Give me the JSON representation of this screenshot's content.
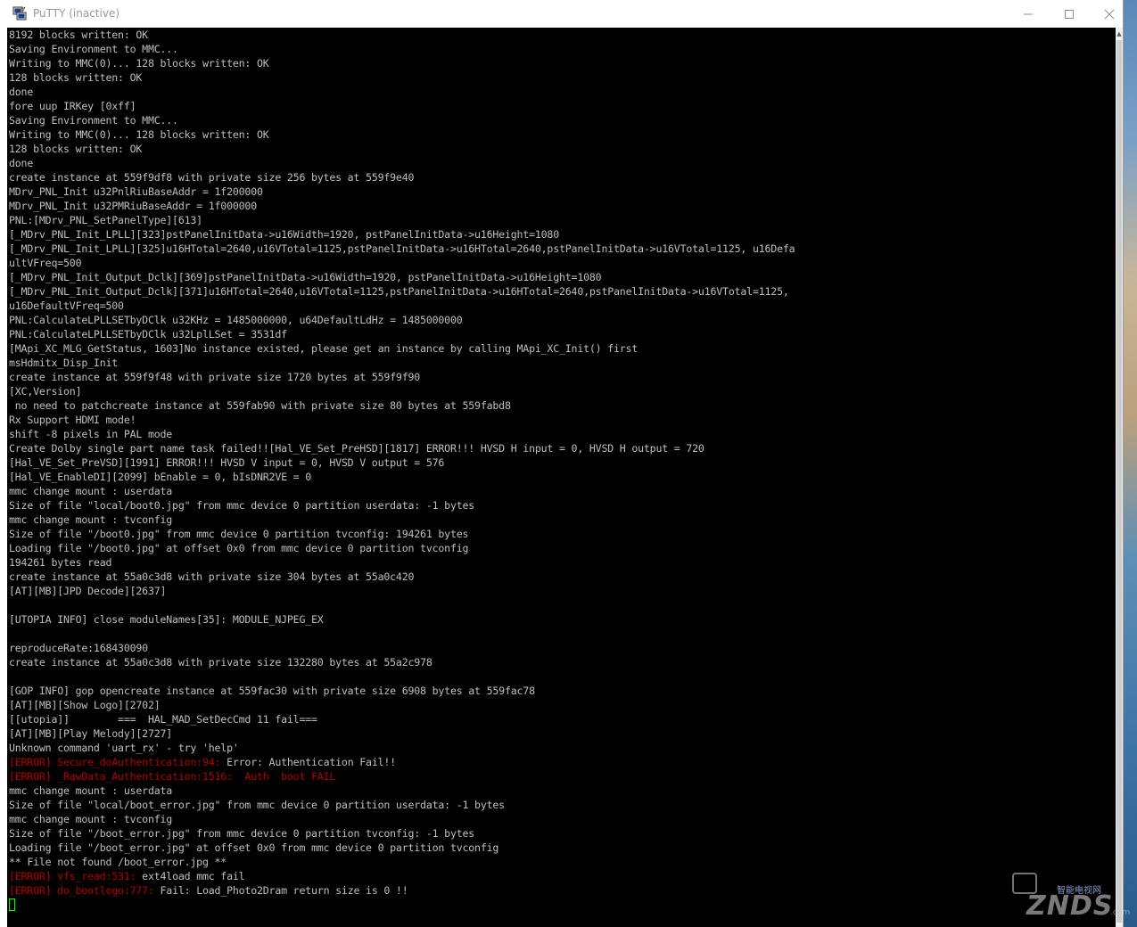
{
  "window": {
    "title": "PuTTY (inactive)",
    "minimize_icon": "minimize-icon",
    "maximize_icon": "maximize-icon",
    "close_icon": "close-icon",
    "app_icon": "putty-icon"
  },
  "terminal": {
    "colors": {
      "background": "#000000",
      "text": "#bfbfbf",
      "error": "#b40000",
      "cursor": "#00ff00"
    },
    "lines": [
      [
        {
          "t": "8192 blocks written: OK"
        }
      ],
      [
        {
          "t": "Saving Environment to MMC..."
        }
      ],
      [
        {
          "t": "Writing to MMC(0)... 128 blocks written: OK"
        }
      ],
      [
        {
          "t": "128 blocks written: OK"
        }
      ],
      [
        {
          "t": "done"
        }
      ],
      [
        {
          "t": "fore uup IRKey [0xff]"
        }
      ],
      [
        {
          "t": "Saving Environment to MMC..."
        }
      ],
      [
        {
          "t": "Writing to MMC(0)... 128 blocks written: OK"
        }
      ],
      [
        {
          "t": "128 blocks written: OK"
        }
      ],
      [
        {
          "t": "done"
        }
      ],
      [
        {
          "t": "create instance at 559f9df8 with private size 256 bytes at 559f9e40"
        }
      ],
      [
        {
          "t": "MDrv_PNL_Init u32PnlRiuBaseAddr = 1f200000"
        }
      ],
      [
        {
          "t": "MDrv_PNL_Init u32PMRiuBaseAddr = 1f000000"
        }
      ],
      [
        {
          "t": "PNL:[MDrv_PNL_SetPanelType][613]"
        }
      ],
      [
        {
          "t": "[_MDrv_PNL_Init_LPLL][323]pstPanelInitData->u16Width=1920, pstPanelInitData->u16Height=1080"
        }
      ],
      [
        {
          "t": "[_MDrv_PNL_Init_LPLL][325]u16HTotal=2640,u16VTotal=1125,pstPanelInitData->u16HTotal=2640,pstPanelInitData->u16VTotal=1125, u16Defa"
        }
      ],
      [
        {
          "t": "ultVFreq=500"
        }
      ],
      [
        {
          "t": "[_MDrv_PNL_Init_Output_Dclk][369]pstPanelInitData->u16Width=1920, pstPanelInitData->u16Height=1080"
        }
      ],
      [
        {
          "t": "[_MDrv_PNL_Init_Output_Dclk][371]u16HTotal=2640,u16VTotal=1125,pstPanelInitData->u16HTotal=2640,pstPanelInitData->u16VTotal=1125,"
        }
      ],
      [
        {
          "t": "u16DefaultVFreq=500"
        }
      ],
      [
        {
          "t": "PNL:CalculateLPLLSETbyDClk u32KHz = 1485000000, u64DefaultLdHz = 1485000000"
        }
      ],
      [
        {
          "t": "PNL:CalculateLPLLSETbyDClk u32LplLSet = 3531df"
        }
      ],
      [
        {
          "t": "[MApi_XC_MLG_GetStatus, 1603]No instance existed, please get an instance by calling MApi_XC_Init() first"
        }
      ],
      [
        {
          "t": "msHdmitx_Disp_Init"
        }
      ],
      [
        {
          "t": "create instance at 559f9f48 with private size 1720 bytes at 559f9f90"
        }
      ],
      [
        {
          "t": "[XC,Version]"
        }
      ],
      [
        {
          "t": " no need to patchcreate instance at 559fab90 with private size 80 bytes at 559fabd8"
        }
      ],
      [
        {
          "t": "Rx Support HDMI mode!"
        }
      ],
      [
        {
          "t": "shift -8 pixels in PAL mode"
        }
      ],
      [
        {
          "t": "Create Dolby single part name task failed!![Hal_VE_Set_PreHSD][1817] ERROR!!! HVSD H input = 0, HVSD H output = 720"
        }
      ],
      [
        {
          "t": "[Hal_VE_Set_PreVSD][1991] ERROR!!! HVSD V input = 0, HVSD V output = 576"
        }
      ],
      [
        {
          "t": "[Hal_VE_EnableDI][2099] bEnable = 0, bIsDNR2VE = 0"
        }
      ],
      [
        {
          "t": "mmc change mount : userdata"
        }
      ],
      [
        {
          "t": "Size of file \"local/boot0.jpg\" from mmc device 0 partition userdata: -1 bytes"
        }
      ],
      [
        {
          "t": "mmc change mount : tvconfig"
        }
      ],
      [
        {
          "t": "Size of file \"/boot0.jpg\" from mmc device 0 partition tvconfig: 194261 bytes"
        }
      ],
      [
        {
          "t": "Loading file \"/boot0.jpg\" at offset 0x0 from mmc device 0 partition tvconfig"
        }
      ],
      [
        {
          "t": "194261 bytes read"
        }
      ],
      [
        {
          "t": "create instance at 55a0c3d8 with private size 304 bytes at 55a0c420"
        }
      ],
      [
        {
          "t": "[AT][MB][JPD Decode][2637]"
        }
      ],
      [
        {
          "t": ""
        }
      ],
      [
        {
          "t": "[UTOPIA INFO] close moduleNames[35]: MODULE_NJPEG_EX"
        }
      ],
      [
        {
          "t": ""
        }
      ],
      [
        {
          "t": "reproduceRate:168430090"
        }
      ],
      [
        {
          "t": "create instance at 55a0c3d8 with private size 132280 bytes at 55a2c978"
        }
      ],
      [
        {
          "t": ""
        }
      ],
      [
        {
          "t": "[GOP INFO] gop opencreate instance at 559fac30 with private size 6908 bytes at 559fac78"
        }
      ],
      [
        {
          "t": "[AT][MB][Show Logo][2702]"
        }
      ],
      [
        {
          "t": "[[utopia]]        ===  HAL_MAD_SetDecCmd 11 fail==="
        }
      ],
      [
        {
          "t": "[AT][MB][Play Melody][2727]"
        }
      ],
      [
        {
          "t": "Unknown command 'uart_rx' - try 'help'"
        }
      ],
      [
        {
          "t": "[ERROR] Secure_doAuthentication:94: ",
          "c": "red"
        },
        {
          "t": "Error: Authentication Fail!!"
        }
      ],
      [
        {
          "t": "[ERROR] _RawData_Authentication:1516:  Auth  boot FAIL",
          "c": "red"
        }
      ],
      [
        {
          "t": "mmc change mount : userdata"
        }
      ],
      [
        {
          "t": "Size of file \"local/boot_error.jpg\" from mmc device 0 partition userdata: -1 bytes"
        }
      ],
      [
        {
          "t": "mmc change mount : tvconfig"
        }
      ],
      [
        {
          "t": "Size of file \"/boot_error.jpg\" from mmc device 0 partition tvconfig: -1 bytes"
        }
      ],
      [
        {
          "t": "Loading file \"/boot_error.jpg\" at offset 0x0 from mmc device 0 partition tvconfig"
        }
      ],
      [
        {
          "t": "** File not found /boot_error.jpg **"
        }
      ],
      [
        {
          "t": "[ERROR] vfs_read:531: ",
          "c": "red"
        },
        {
          "t": "ext4load mmc fail"
        }
      ],
      [
        {
          "t": "[ERROR] do_bootlogo:777: ",
          "c": "red"
        },
        {
          "t": "Fail: Load_Photo2Dram return size is 0 !!"
        }
      ]
    ]
  },
  "watermark": {
    "brand": "ZNDS",
    "cn": "智能电视网",
    "suffix": ".com"
  }
}
